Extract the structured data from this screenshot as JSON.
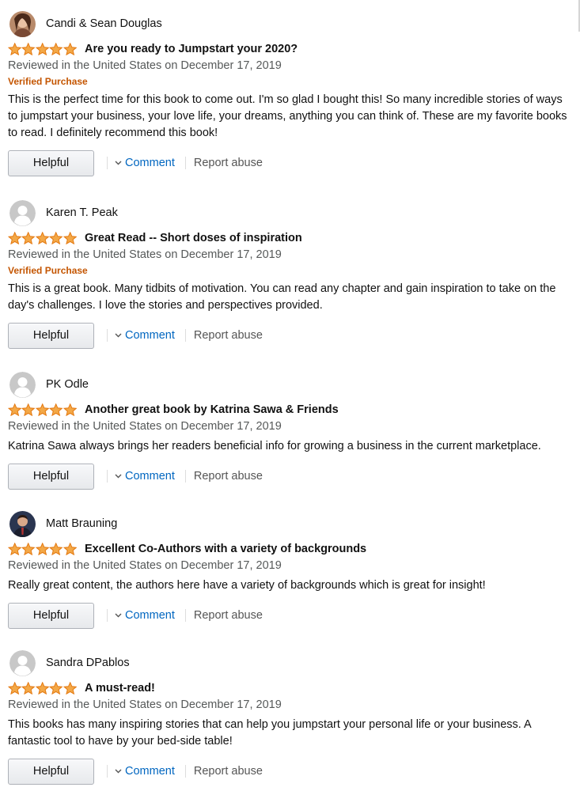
{
  "colors": {
    "star_fill": "#f3a847",
    "star_stroke": "#e47911",
    "verified": "#c45500",
    "link": "#0066c0",
    "muted": "#565959"
  },
  "reviews": [
    {
      "profile_name": "Candi & Sean Douglas",
      "avatar": "photo-avatar",
      "rating_stars": 5,
      "title": "Are you ready to Jumpstart your 2020?",
      "date": "Reviewed in the United States on December 17, 2019",
      "verified": "Verified Purchase",
      "body": "This is the perfect time for this book to come out. I'm so glad I bought this! So many incredible stories of ways to jumpstart your business, your love life, your dreams, anything you can think of. These are my favorite books to read. I definitely recommend this book!",
      "helpful_label": "Helpful",
      "comment_label": "Comment",
      "report_label": "Report abuse"
    },
    {
      "profile_name": "Karen T. Peak",
      "avatar": "default-avatar",
      "rating_stars": 5,
      "title": "Great Read -- Short doses of inspiration",
      "date": "Reviewed in the United States on December 17, 2019",
      "verified": "Verified Purchase",
      "body": "This is a great book. Many tidbits of motivation. You can read any chapter and gain inspiration to take on the day's challenges. I love the stories and perspectives provided.",
      "helpful_label": "Helpful",
      "comment_label": "Comment",
      "report_label": "Report abuse"
    },
    {
      "profile_name": "PK Odle",
      "avatar": "default-avatar",
      "rating_stars": 5,
      "title": "Another great book by Katrina Sawa & Friends",
      "date": "Reviewed in the United States on December 17, 2019",
      "body": "Katrina Sawa always brings her readers beneficial info for growing a business in the current marketplace.",
      "helpful_label": "Helpful",
      "comment_label": "Comment",
      "report_label": "Report abuse"
    },
    {
      "profile_name": "Matt Brauning",
      "avatar": "photo-avatar",
      "rating_stars": 5,
      "title": "Excellent Co-Authors with a variety of backgrounds",
      "date": "Reviewed in the United States on December 17, 2019",
      "body": "Really great content, the authors here have a variety of backgrounds which is great for insight!",
      "helpful_label": "Helpful",
      "comment_label": "Comment",
      "report_label": "Report abuse"
    },
    {
      "profile_name": "Sandra DPablos",
      "avatar": "default-avatar",
      "rating_stars": 5,
      "title": "A must-read!",
      "date": "Reviewed in the United States on December 17, 2019",
      "body": "This books has many inspiring stories that can help you jumpstart your personal life or your business. A fantastic tool to have by your bed-side table!",
      "helpful_label": "Helpful",
      "comment_label": "Comment",
      "report_label": "Report abuse"
    }
  ]
}
